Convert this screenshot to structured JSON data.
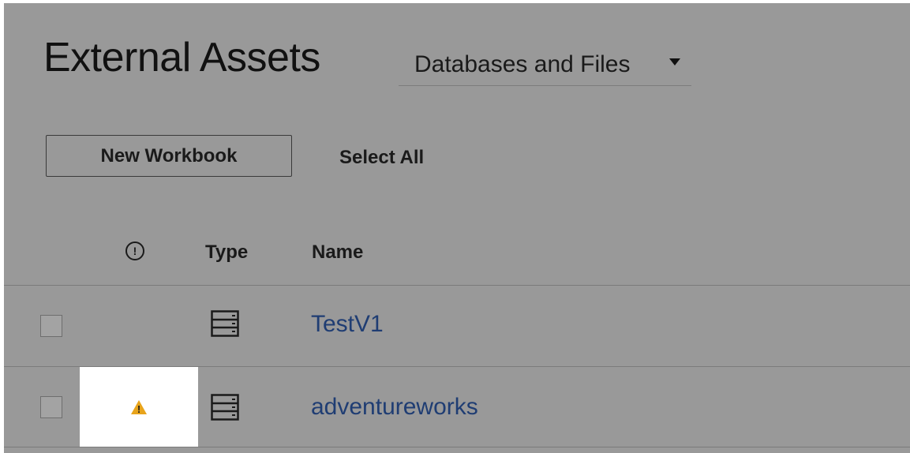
{
  "page": {
    "title": "External Assets",
    "filter": {
      "selected": "Databases and Files"
    }
  },
  "toolbar": {
    "new_workbook_label": "New Workbook",
    "select_all_label": "Select All"
  },
  "table": {
    "columns": {
      "alert_icon_glyph": "!",
      "type": "Type",
      "name": "Name"
    },
    "rows": [
      {
        "name": "TestV1",
        "type_icon": "database-icon",
        "has_warning": false,
        "selected": false
      },
      {
        "name": "adventureworks",
        "type_icon": "database-icon",
        "has_warning": true,
        "warning_glyph": "!",
        "selected": false
      }
    ]
  },
  "colors": {
    "overlay": "#999999",
    "link": "#1f3d73",
    "warning": "#e8a41c",
    "highlight": "#ffffff"
  }
}
